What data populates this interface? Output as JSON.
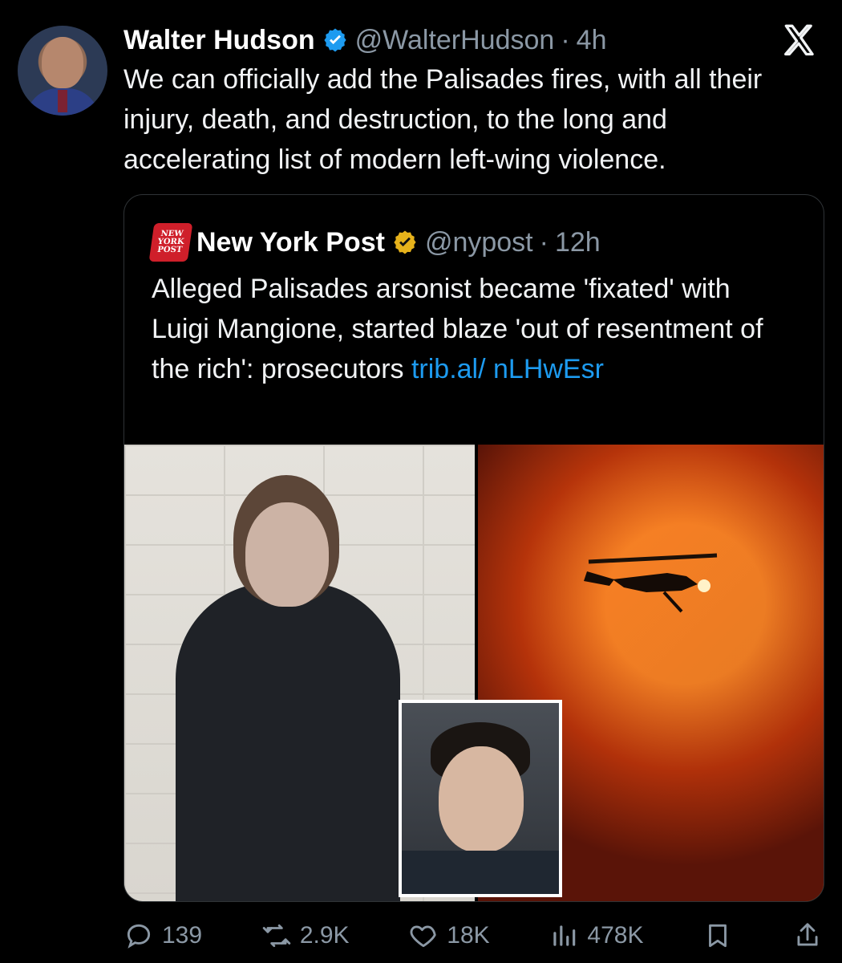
{
  "tweet": {
    "author_name": "Walter Hudson",
    "author_handle": "@WalterHudson",
    "dot": "·",
    "time": "4h",
    "text": "We can officially add the Palisades fires, with all their injury, death, and destruction, to the long and accelerating list of modern left-wing violence."
  },
  "quote": {
    "logo_text": "NEW YORK POST",
    "source_name": "New York Post",
    "source_handle": "@nypost",
    "dot": "·",
    "time": "12h",
    "text": "Alleged Palisades arsonist became 'fixated' with Luigi Mangione, started blaze 'out of resentment of the rich': prosecutors ",
    "link_text": "trib.al/\nnLHwEsr"
  },
  "actions": {
    "replies": "139",
    "reposts": "2.9K",
    "likes": "18K",
    "views": "478K"
  },
  "icons": {
    "verified": "blue-verified-icon",
    "gold_verified": "gold-verified-icon",
    "x_logo": "x-logo-icon",
    "reply": "reply-icon",
    "repost": "repost-icon",
    "like": "heart-icon",
    "views": "views-icon",
    "bookmark": "bookmark-icon",
    "share": "share-icon"
  },
  "colors": {
    "background": "#000000",
    "text": "#e7e9ea",
    "muted": "#8b98a5",
    "link": "#1d9bf0",
    "verified_blue": "#1d9bf0",
    "verified_gold": "#e6b21b",
    "border": "#2f3336"
  }
}
